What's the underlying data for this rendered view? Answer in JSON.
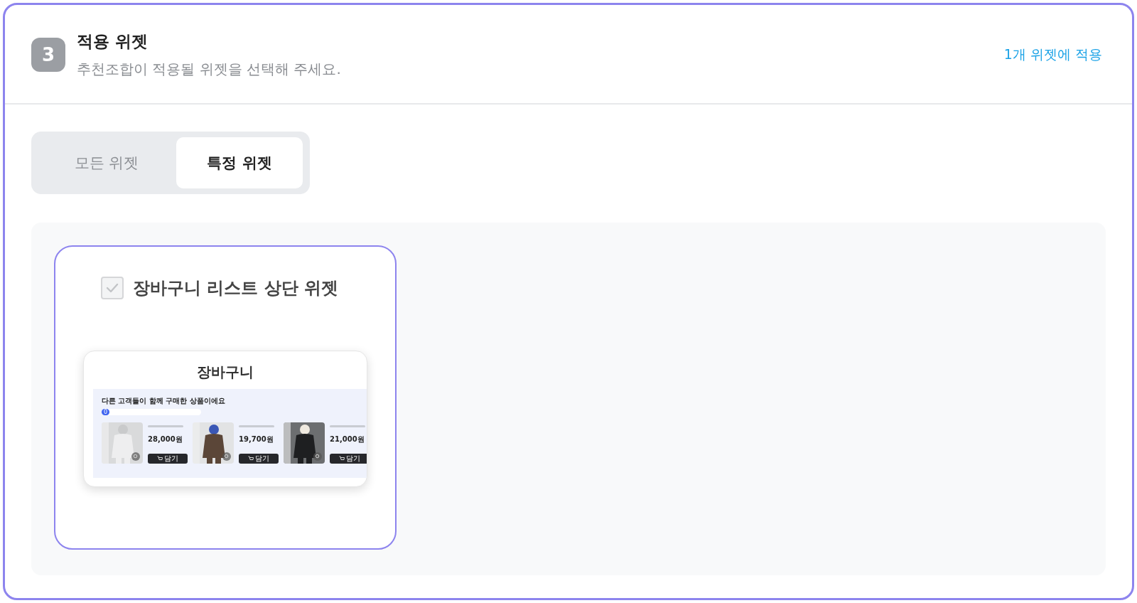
{
  "step": {
    "number": "3",
    "title": "적용 위젯",
    "description": "추천조합이 적용될 위젯을 선택해 주세요.",
    "action": "1개 위젯에 적용"
  },
  "scope_tabs": [
    {
      "label": "모든 위젯",
      "selected": false
    },
    {
      "label": "특정 위젯",
      "selected": true
    }
  ],
  "widgets": [
    {
      "label": "장바구니 리스트 상단 위젯",
      "checked": true,
      "disabled": true,
      "preview": {
        "title": "장바구니",
        "heading": "다른 고객들이 함께 구매한 상품이에요",
        "progress_label": "0",
        "level": 0.08,
        "products": [
          {
            "kind": "picture",
            "price": "28,000원",
            "button": "담기"
          },
          {
            "kind": "picture",
            "price": "19,700원",
            "button": "담기"
          },
          {
            "kind": "picture",
            "price": "21,000원",
            "button": "담기"
          }
        ]
      }
    }
  ]
}
